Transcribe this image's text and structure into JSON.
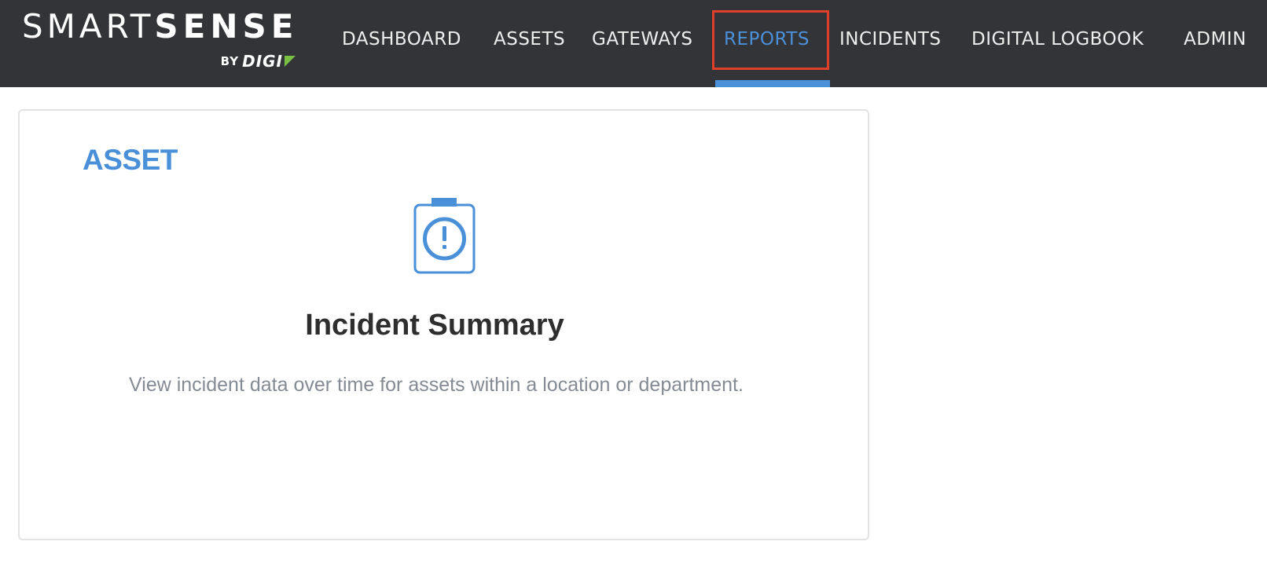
{
  "header": {
    "logo": {
      "word1": "SMART",
      "word2": "SENSE",
      "by": "BY",
      "brand": "DIGI"
    },
    "nav": {
      "items": [
        {
          "label": "DASHBOARD"
        },
        {
          "label": "ASSETS"
        },
        {
          "label": "GATEWAYS"
        },
        {
          "label": "REPORTS"
        },
        {
          "label": "INCIDENTS"
        },
        {
          "label": "DIGITAL LOGBOOK"
        },
        {
          "label": "ADMIN"
        }
      ],
      "active": "REPORTS"
    }
  },
  "main": {
    "card": {
      "category": "ASSET",
      "icon": "clipboard-alert-icon",
      "title": "Incident Summary",
      "description": "View incident data over time for assets within a location or department."
    }
  },
  "colors": {
    "header_bg": "#333438",
    "accent": "#4a90d9",
    "highlight": "#e0402a",
    "logo_mark": "#78c043"
  }
}
